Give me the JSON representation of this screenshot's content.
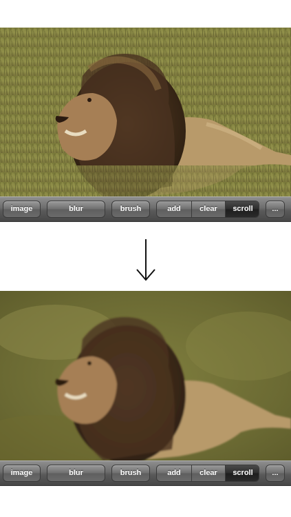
{
  "top_panel": {
    "image_icon": "lion-photo-sharp",
    "toolbar": {
      "image_label": "image",
      "blur_label": "blur",
      "brush_label": "brush",
      "mode_segment": [
        "add",
        "clear",
        "scroll"
      ],
      "selected_mode": "scroll",
      "more_label": "..."
    }
  },
  "arrow_icon": "down-arrow-icon",
  "bottom_panel": {
    "image_icon": "lion-photo-blurred-background",
    "toolbar": {
      "image_label": "image",
      "blur_label": "blur",
      "brush_label": "brush",
      "mode_segment": [
        "add",
        "clear",
        "scroll"
      ],
      "selected_mode": "scroll",
      "more_label": "..."
    }
  }
}
